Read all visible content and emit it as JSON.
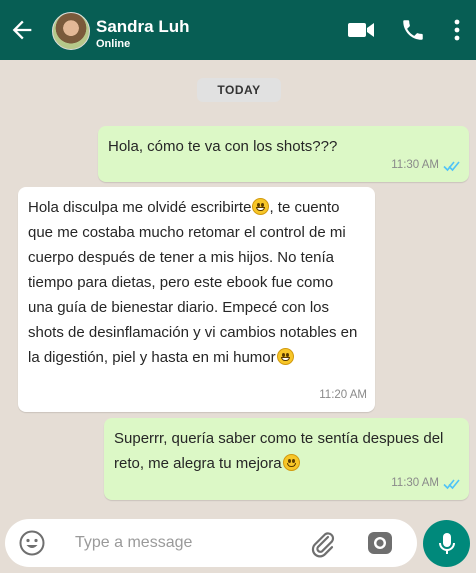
{
  "header": {
    "contact_name": "Sandra Luh",
    "status": "Online",
    "icons": [
      "back-arrow-icon",
      "video-call-icon",
      "phone-icon",
      "more-options-icon"
    ],
    "background": "#075e54"
  },
  "chat": {
    "date_label": "TODAY",
    "background": "#e5ddd5",
    "messages": [
      {
        "direction": "outgoing",
        "text": "Hola, cómo te va con los shots???",
        "time": "11:30 AM",
        "read": true
      },
      {
        "direction": "incoming",
        "text_parts": [
          "Hola disculpa me olvidé escribirte",
          ", te cuento que me costaba mucho retomar el control de mi cuerpo después de tener a mis hijos. No tenía tiempo para dietas, pero este ebook fue como una guía de bienestar diario. Empecé con los shots de desinflamación y vi cambios notables en la digestión, piel y hasta en mi humor"
        ],
        "emoji": "grinning-face",
        "time": "11:20 AM"
      },
      {
        "direction": "outgoing",
        "text": "Superrr, quería saber como te sentía despues del reto, me alegra tu mejora",
        "emoji": "smiling-face",
        "time": "11:30 AM",
        "read": true
      }
    ]
  },
  "composer": {
    "placeholder": "Type a message",
    "value": "",
    "icons": [
      "emoji-icon",
      "attach-icon",
      "camera-icon",
      "microphone-icon"
    ]
  },
  "colors": {
    "outgoing_bubble": "#dcf8c6",
    "incoming_bubble": "#ffffff",
    "read_ticks": "#4fc3f7",
    "mic_button": "#00897b"
  }
}
